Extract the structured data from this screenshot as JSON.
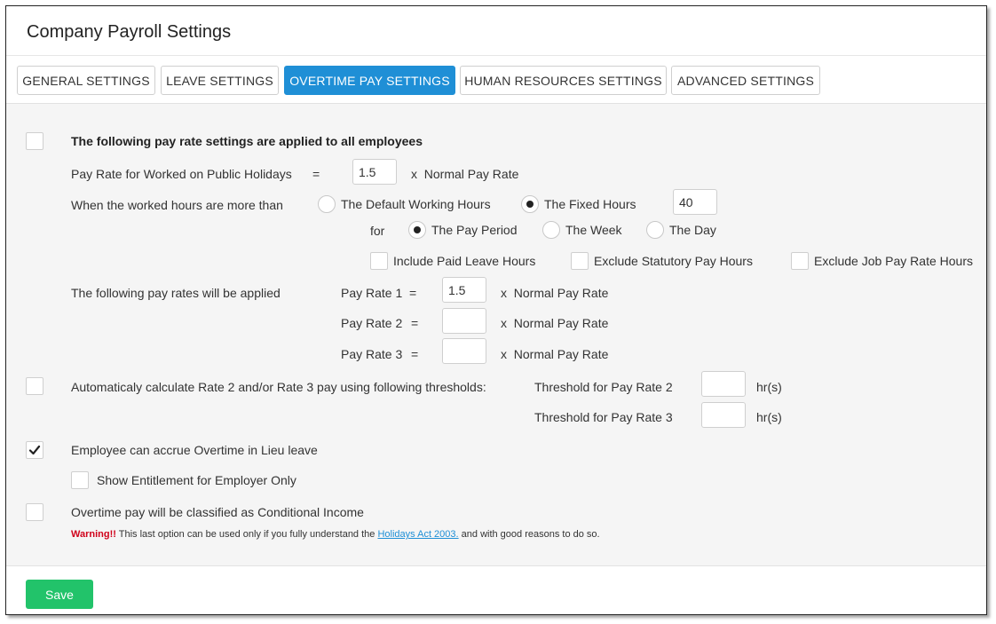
{
  "header": {
    "title": "Company Payroll Settings"
  },
  "tabs": [
    {
      "label": "GENERAL SETTINGS"
    },
    {
      "label": "LEAVE SETTINGS"
    },
    {
      "label": "OVERTIME PAY SETTINGS"
    },
    {
      "label": "HUMAN RESOURCES SETTINGS"
    },
    {
      "label": "ADVANCED SETTINGS"
    }
  ],
  "active_tab": "OVERTIME PAY SETTINGS",
  "form": {
    "apply_all_label": "The following pay rate settings are applied to all employees",
    "apply_all_checked": false,
    "public_holiday": {
      "label": "Pay Rate for Worked on Public Holidays",
      "equals": "=",
      "value": "1.5",
      "suffix": "x  Normal Pay Rate"
    },
    "worked_hours": {
      "label": "When the worked hours are more than",
      "option_default": "The Default Working Hours",
      "option_fixed": "The Fixed Hours",
      "selected": "The Fixed Hours",
      "fixed_hours_value": "40",
      "for_label": "for",
      "period_options": [
        "The Pay Period",
        "The Week",
        "The Day"
      ],
      "selected_period": "The Pay Period",
      "include_paid_leave": "Include Paid Leave Hours",
      "exclude_statutory": "Exclude Statutory Pay Hours",
      "exclude_job_rate": "Exclude Job Pay Rate Hours"
    },
    "pay_rates": {
      "label": "The following pay rates will be applied",
      "rates": [
        {
          "label": "Pay Rate 1",
          "equals": "=",
          "value": "1.5",
          "suffix": "x  Normal Pay Rate"
        },
        {
          "label": "Pay Rate 2",
          "equals": "=",
          "value": "",
          "suffix": "x  Normal Pay Rate"
        },
        {
          "label": "Pay Rate 3",
          "equals": "=",
          "value": "",
          "suffix": "x  Normal Pay Rate"
        }
      ]
    },
    "auto_calc": {
      "label": "Automaticaly calculate Rate 2 and/or Rate 3 pay using following thresholds:",
      "checked": false,
      "threshold2_label": "Threshold for Pay Rate 2",
      "threshold3_label": "Threshold for Pay Rate 3",
      "threshold2_value": "",
      "threshold3_value": "",
      "unit": "hr(s)"
    },
    "lieu": {
      "label": "Employee can accrue Overtime in Lieu leave",
      "checked": true,
      "show_entitlement_label": "Show Entitlement for Employer Only",
      "show_entitlement_checked": false
    },
    "conditional": {
      "label": "Overtime pay will be classified as Conditional Income",
      "checked": false,
      "warning_prefix": "Warning!!",
      "warning_text": "This last option can be used only if you fully understand the",
      "warning_link": "Holidays Act 2003.",
      "warning_suffix": "and with good reasons to do so."
    }
  },
  "footer": {
    "save_label": "Save"
  },
  "colors": {
    "accent": "#1f8fd6",
    "save_button": "#22c36a",
    "warning": "#d0021b",
    "panel_bg": "#f5f5f5"
  }
}
